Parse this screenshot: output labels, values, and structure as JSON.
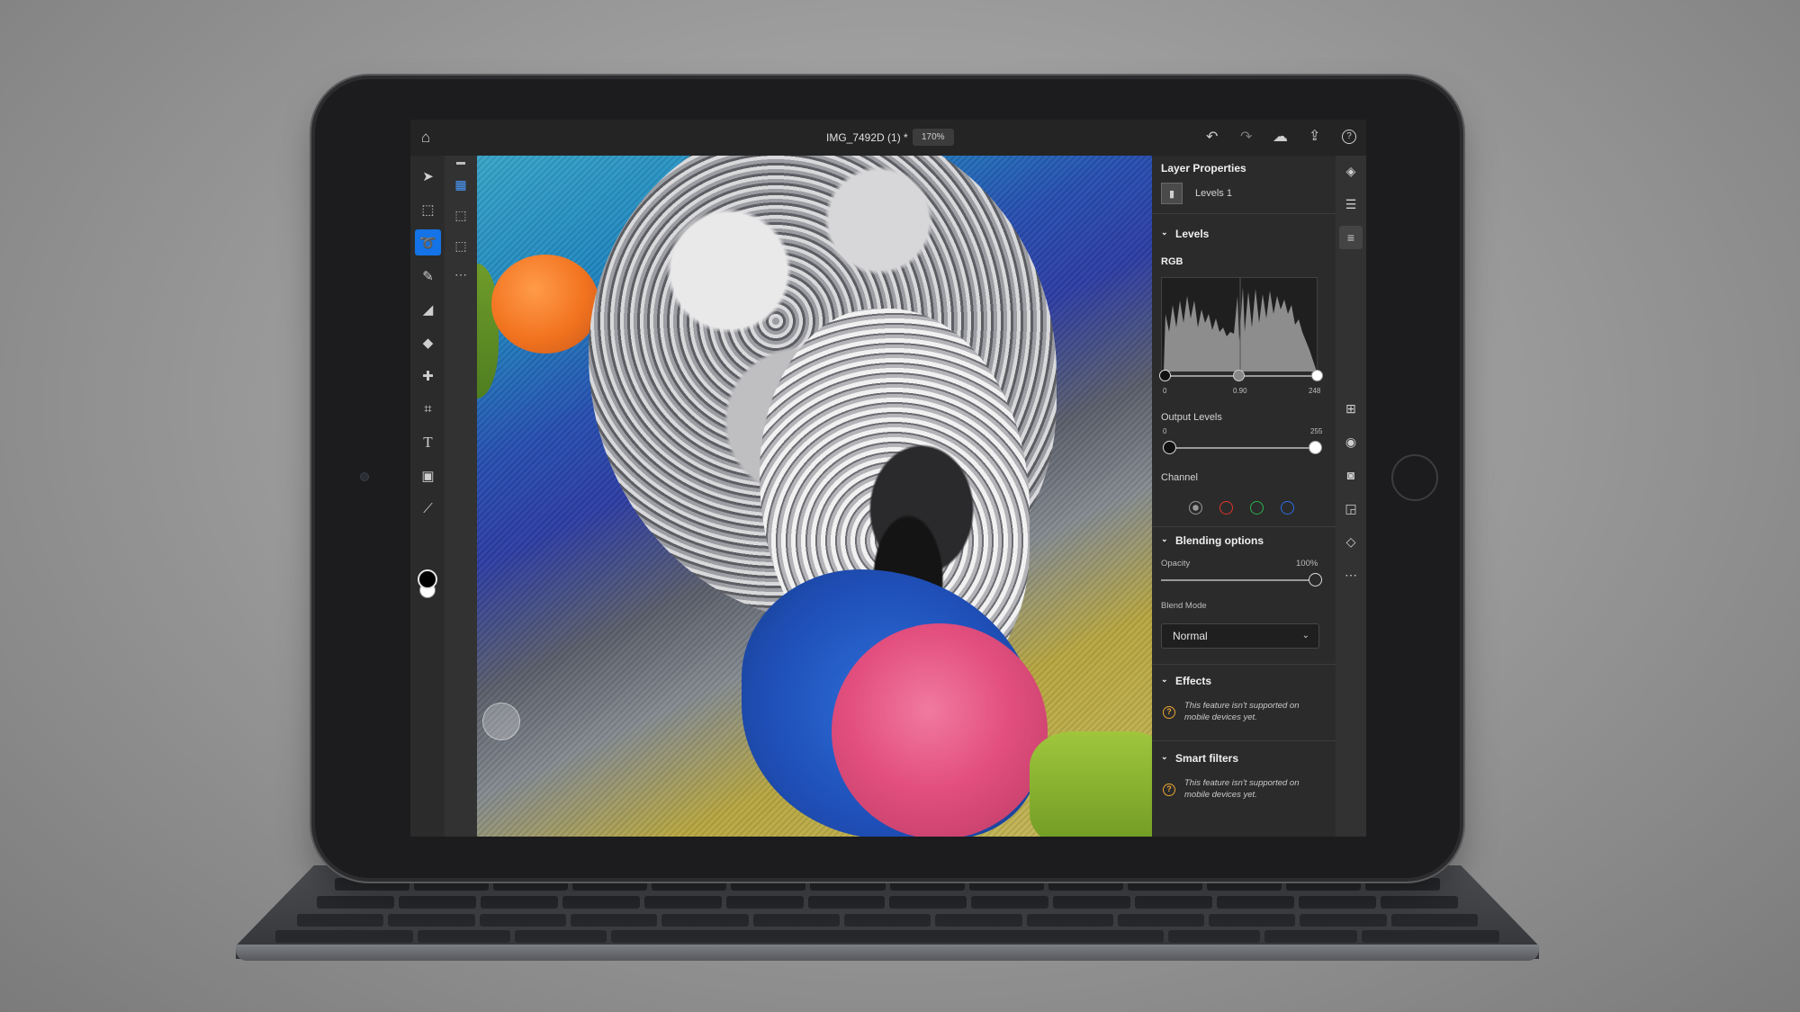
{
  "document": {
    "title": "IMG_7492D (1) *",
    "zoom": "170%"
  },
  "topbar": {
    "icons": [
      "home-icon",
      "undo-icon",
      "redo-icon",
      "cloud-icon",
      "share-icon",
      "help-icon"
    ]
  },
  "toolbar": {
    "tools": [
      "move-icon",
      "transform-icon",
      "lasso-select-icon",
      "brush-icon",
      "eraser-icon",
      "fill-icon",
      "healing-brush-icon",
      "crop-icon",
      "type-icon",
      "place-image-icon",
      "eyedropper-icon"
    ],
    "active_tool": "lasso-select-icon",
    "foreground_color": "#000000",
    "background_color": "#ffffff"
  },
  "subtools": {
    "items": [
      "new-selection-icon",
      "add-selection-icon",
      "subtract-selection-icon",
      "more-icon"
    ],
    "selected": "new-selection-icon"
  },
  "panel": {
    "title": "Layer Properties",
    "layer_name": "Levels 1",
    "levels": {
      "section": "Levels",
      "channel_name": "RGB",
      "input_black": "0",
      "input_gamma": "0.90",
      "input_white": "248",
      "output_title": "Output Levels",
      "output_black": "0",
      "output_white": "255"
    },
    "channel": {
      "label": "Channel",
      "options": [
        {
          "name": "composite",
          "color": "#9a9a9a"
        },
        {
          "name": "red",
          "color": "#e0332b"
        },
        {
          "name": "green",
          "color": "#2bb24c"
        },
        {
          "name": "blue",
          "color": "#2f6ee6"
        }
      ]
    },
    "blending": {
      "section": "Blending options",
      "opacity_label": "Opacity",
      "opacity_value": "100%",
      "blend_mode_label": "Blend Mode",
      "blend_mode_value": "Normal"
    },
    "effects": {
      "section": "Effects",
      "message": "This feature isn't supported on mobile devices yet."
    },
    "smart_filters": {
      "section": "Smart filters",
      "message": "This feature isn't supported on mobile devices yet."
    }
  },
  "rail": {
    "icons": [
      "layers-icon",
      "layer-details-icon",
      "properties-icon",
      "add-layer-icon",
      "visibility-icon",
      "mask-icon",
      "clip-icon",
      "adjust-icon",
      "more-icon"
    ],
    "active": "properties-icon"
  },
  "colors": {
    "accent": "#1473e6",
    "warning": "#e8a534"
  }
}
